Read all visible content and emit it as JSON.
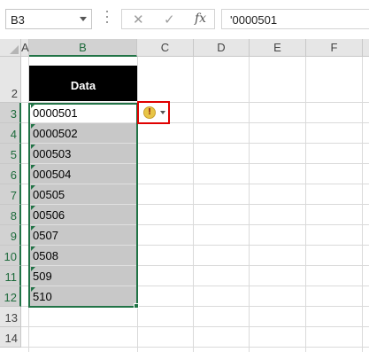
{
  "formula_bar": {
    "name_box": "B3",
    "cancel_symbol": "✕",
    "enter_symbol": "✓",
    "fx_symbol": "fx",
    "formula_value": "'0000501"
  },
  "columns": [
    "A",
    "B",
    "C",
    "D",
    "E",
    "F"
  ],
  "rows": [
    "2",
    "3",
    "4",
    "5",
    "6",
    "7",
    "8",
    "9",
    "10",
    "11",
    "12",
    "13",
    "14"
  ],
  "table_header": "Data",
  "values": [
    "0000501",
    "0000502",
    "000503",
    "000504",
    "00505",
    "00506",
    "0507",
    "0508",
    "509",
    "510"
  ],
  "error_indicator": {
    "icon": "warning-icon",
    "symbol": "!"
  },
  "colors": {
    "selection_accent": "#217346",
    "error_border": "#e00000",
    "header_fill": "#000000",
    "selected_fill": "#c8c8c8"
  }
}
